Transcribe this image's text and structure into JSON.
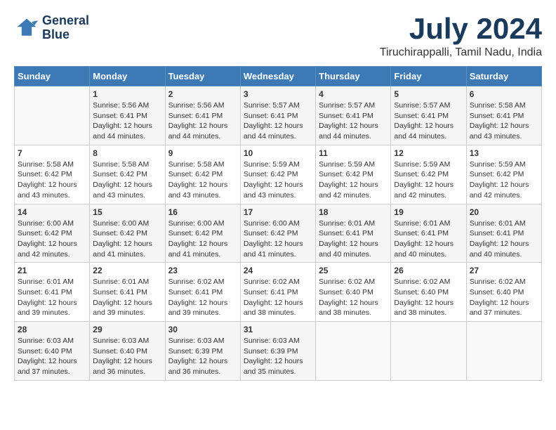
{
  "header": {
    "logo_line1": "General",
    "logo_line2": "Blue",
    "title": "July 2024",
    "subtitle": "Tiruchirappalli, Tamil Nadu, India"
  },
  "calendar": {
    "days_of_week": [
      "Sunday",
      "Monday",
      "Tuesday",
      "Wednesday",
      "Thursday",
      "Friday",
      "Saturday"
    ],
    "weeks": [
      [
        {
          "day": "",
          "sunrise": "",
          "sunset": "",
          "daylight": ""
        },
        {
          "day": "1",
          "sunrise": "Sunrise: 5:56 AM",
          "sunset": "Sunset: 6:41 PM",
          "daylight": "Daylight: 12 hours and 44 minutes."
        },
        {
          "day": "2",
          "sunrise": "Sunrise: 5:56 AM",
          "sunset": "Sunset: 6:41 PM",
          "daylight": "Daylight: 12 hours and 44 minutes."
        },
        {
          "day": "3",
          "sunrise": "Sunrise: 5:57 AM",
          "sunset": "Sunset: 6:41 PM",
          "daylight": "Daylight: 12 hours and 44 minutes."
        },
        {
          "day": "4",
          "sunrise": "Sunrise: 5:57 AM",
          "sunset": "Sunset: 6:41 PM",
          "daylight": "Daylight: 12 hours and 44 minutes."
        },
        {
          "day": "5",
          "sunrise": "Sunrise: 5:57 AM",
          "sunset": "Sunset: 6:41 PM",
          "daylight": "Daylight: 12 hours and 44 minutes."
        },
        {
          "day": "6",
          "sunrise": "Sunrise: 5:58 AM",
          "sunset": "Sunset: 6:41 PM",
          "daylight": "Daylight: 12 hours and 43 minutes."
        }
      ],
      [
        {
          "day": "7",
          "sunrise": "Sunrise: 5:58 AM",
          "sunset": "Sunset: 6:42 PM",
          "daylight": "Daylight: 12 hours and 43 minutes."
        },
        {
          "day": "8",
          "sunrise": "Sunrise: 5:58 AM",
          "sunset": "Sunset: 6:42 PM",
          "daylight": "Daylight: 12 hours and 43 minutes."
        },
        {
          "day": "9",
          "sunrise": "Sunrise: 5:58 AM",
          "sunset": "Sunset: 6:42 PM",
          "daylight": "Daylight: 12 hours and 43 minutes."
        },
        {
          "day": "10",
          "sunrise": "Sunrise: 5:59 AM",
          "sunset": "Sunset: 6:42 PM",
          "daylight": "Daylight: 12 hours and 43 minutes."
        },
        {
          "day": "11",
          "sunrise": "Sunrise: 5:59 AM",
          "sunset": "Sunset: 6:42 PM",
          "daylight": "Daylight: 12 hours and 42 minutes."
        },
        {
          "day": "12",
          "sunrise": "Sunrise: 5:59 AM",
          "sunset": "Sunset: 6:42 PM",
          "daylight": "Daylight: 12 hours and 42 minutes."
        },
        {
          "day": "13",
          "sunrise": "Sunrise: 5:59 AM",
          "sunset": "Sunset: 6:42 PM",
          "daylight": "Daylight: 12 hours and 42 minutes."
        }
      ],
      [
        {
          "day": "14",
          "sunrise": "Sunrise: 6:00 AM",
          "sunset": "Sunset: 6:42 PM",
          "daylight": "Daylight: 12 hours and 42 minutes."
        },
        {
          "day": "15",
          "sunrise": "Sunrise: 6:00 AM",
          "sunset": "Sunset: 6:42 PM",
          "daylight": "Daylight: 12 hours and 41 minutes."
        },
        {
          "day": "16",
          "sunrise": "Sunrise: 6:00 AM",
          "sunset": "Sunset: 6:42 PM",
          "daylight": "Daylight: 12 hours and 41 minutes."
        },
        {
          "day": "17",
          "sunrise": "Sunrise: 6:00 AM",
          "sunset": "Sunset: 6:42 PM",
          "daylight": "Daylight: 12 hours and 41 minutes."
        },
        {
          "day": "18",
          "sunrise": "Sunrise: 6:01 AM",
          "sunset": "Sunset: 6:41 PM",
          "daylight": "Daylight: 12 hours and 40 minutes."
        },
        {
          "day": "19",
          "sunrise": "Sunrise: 6:01 AM",
          "sunset": "Sunset: 6:41 PM",
          "daylight": "Daylight: 12 hours and 40 minutes."
        },
        {
          "day": "20",
          "sunrise": "Sunrise: 6:01 AM",
          "sunset": "Sunset: 6:41 PM",
          "daylight": "Daylight: 12 hours and 40 minutes."
        }
      ],
      [
        {
          "day": "21",
          "sunrise": "Sunrise: 6:01 AM",
          "sunset": "Sunset: 6:41 PM",
          "daylight": "Daylight: 12 hours and 39 minutes."
        },
        {
          "day": "22",
          "sunrise": "Sunrise: 6:01 AM",
          "sunset": "Sunset: 6:41 PM",
          "daylight": "Daylight: 12 hours and 39 minutes."
        },
        {
          "day": "23",
          "sunrise": "Sunrise: 6:02 AM",
          "sunset": "Sunset: 6:41 PM",
          "daylight": "Daylight: 12 hours and 39 minutes."
        },
        {
          "day": "24",
          "sunrise": "Sunrise: 6:02 AM",
          "sunset": "Sunset: 6:41 PM",
          "daylight": "Daylight: 12 hours and 38 minutes."
        },
        {
          "day": "25",
          "sunrise": "Sunrise: 6:02 AM",
          "sunset": "Sunset: 6:40 PM",
          "daylight": "Daylight: 12 hours and 38 minutes."
        },
        {
          "day": "26",
          "sunrise": "Sunrise: 6:02 AM",
          "sunset": "Sunset: 6:40 PM",
          "daylight": "Daylight: 12 hours and 38 minutes."
        },
        {
          "day": "27",
          "sunrise": "Sunrise: 6:02 AM",
          "sunset": "Sunset: 6:40 PM",
          "daylight": "Daylight: 12 hours and 37 minutes."
        }
      ],
      [
        {
          "day": "28",
          "sunrise": "Sunrise: 6:03 AM",
          "sunset": "Sunset: 6:40 PM",
          "daylight": "Daylight: 12 hours and 37 minutes."
        },
        {
          "day": "29",
          "sunrise": "Sunrise: 6:03 AM",
          "sunset": "Sunset: 6:40 PM",
          "daylight": "Daylight: 12 hours and 36 minutes."
        },
        {
          "day": "30",
          "sunrise": "Sunrise: 6:03 AM",
          "sunset": "Sunset: 6:39 PM",
          "daylight": "Daylight: 12 hours and 36 minutes."
        },
        {
          "day": "31",
          "sunrise": "Sunrise: 6:03 AM",
          "sunset": "Sunset: 6:39 PM",
          "daylight": "Daylight: 12 hours and 35 minutes."
        },
        {
          "day": "",
          "sunrise": "",
          "sunset": "",
          "daylight": ""
        },
        {
          "day": "",
          "sunrise": "",
          "sunset": "",
          "daylight": ""
        },
        {
          "day": "",
          "sunrise": "",
          "sunset": "",
          "daylight": ""
        }
      ]
    ]
  }
}
